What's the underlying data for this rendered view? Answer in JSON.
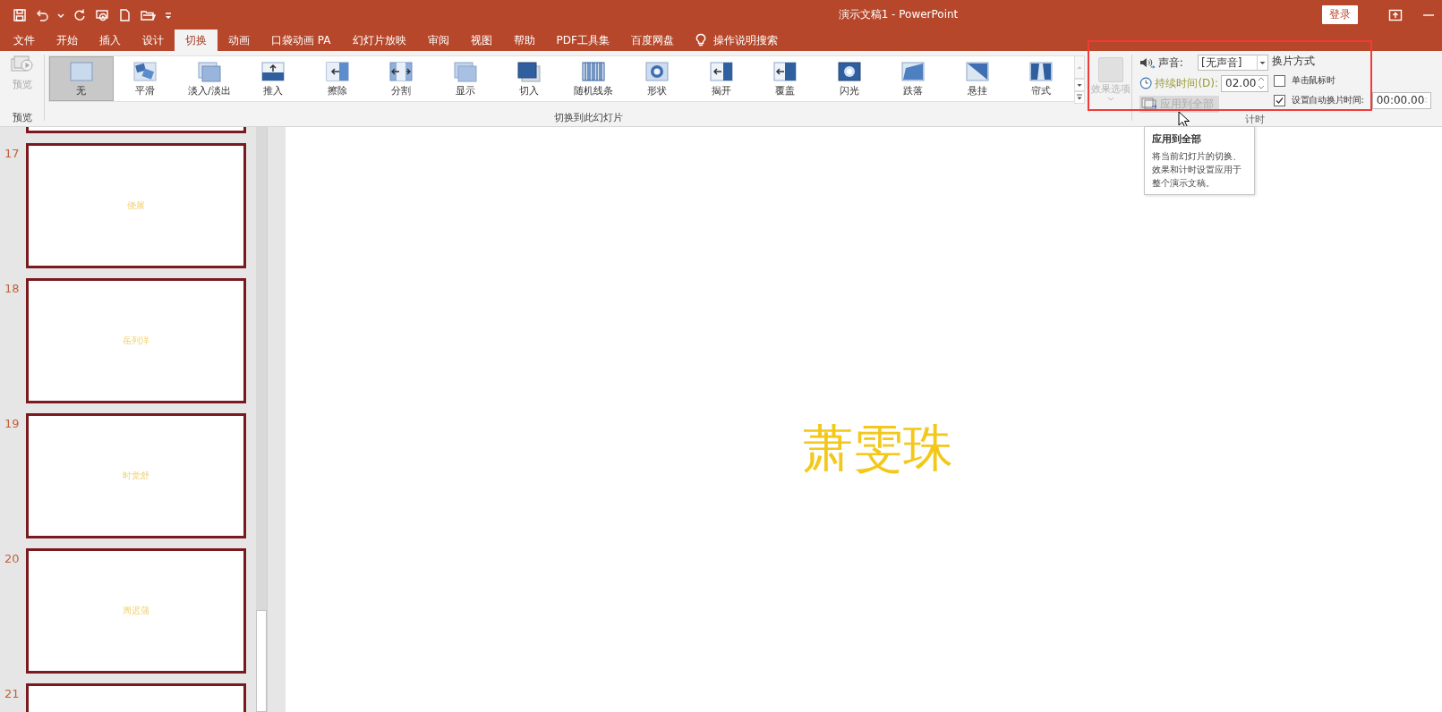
{
  "window": {
    "title": "演示文稿1  -  PowerPoint",
    "sign_in": "登录"
  },
  "tabs": [
    {
      "label": "文件",
      "selected": false
    },
    {
      "label": "开始",
      "selected": false
    },
    {
      "label": "插入",
      "selected": false
    },
    {
      "label": "设计",
      "selected": false
    },
    {
      "label": "切换",
      "selected": true
    },
    {
      "label": "动画",
      "selected": false
    },
    {
      "label": "口袋动画 PA",
      "selected": false
    },
    {
      "label": "幻灯片放映",
      "selected": false
    },
    {
      "label": "审阅",
      "selected": false
    },
    {
      "label": "视图",
      "selected": false
    },
    {
      "label": "帮助",
      "selected": false
    },
    {
      "label": "PDF工具集",
      "selected": false
    },
    {
      "label": "百度网盘",
      "selected": false
    }
  ],
  "search": {
    "label": "操作说明搜索"
  },
  "ribbon": {
    "preview": {
      "label": "预览",
      "disabled": true,
      "group": "预览"
    },
    "transitions": [
      {
        "label": "无",
        "selected": true
      },
      {
        "label": "平滑",
        "selected": false
      },
      {
        "label": "淡入/淡出",
        "selected": false
      },
      {
        "label": "推入",
        "selected": false
      },
      {
        "label": "擦除",
        "selected": false
      },
      {
        "label": "分割",
        "selected": false
      },
      {
        "label": "显示",
        "selected": false
      },
      {
        "label": "切入",
        "selected": false
      },
      {
        "label": "随机线条",
        "selected": false
      },
      {
        "label": "形状",
        "selected": false
      },
      {
        "label": "揭开",
        "selected": false
      },
      {
        "label": "覆盖",
        "selected": false
      },
      {
        "label": "闪光",
        "selected": false
      },
      {
        "label": "跌落",
        "selected": false
      },
      {
        "label": "悬挂",
        "selected": false
      },
      {
        "label": "帘式",
        "selected": false
      }
    ],
    "transitions_group": "切换到此幻灯片",
    "effect_options": {
      "label": "效果选项",
      "disabled": true
    },
    "timing": {
      "sound_label": "声音:",
      "sound_value": "[无声音]",
      "duration_label": "持续时间(D):",
      "duration_value": "02.00",
      "apply_all": "应用到全部",
      "advance_title": "换片方式",
      "on_click": {
        "label": "单击鼠标时",
        "checked": false
      },
      "after": {
        "label": "设置自动换片时间:",
        "checked": true,
        "value": "00:00.00"
      },
      "group": "计时"
    }
  },
  "tooltip": {
    "title": "应用到全部",
    "text": "将当前幻灯片的切换、效果和计时设置应用于整个演示文稿。"
  },
  "slides": [
    {
      "number": "17",
      "text": "侥展"
    },
    {
      "number": "18",
      "text": "岳列洋"
    },
    {
      "number": "19",
      "text": "时觉舒"
    },
    {
      "number": "20",
      "text": "周迟蒲"
    },
    {
      "number": "21"
    }
  ],
  "main_slide": {
    "text": "萧雯珠"
  }
}
